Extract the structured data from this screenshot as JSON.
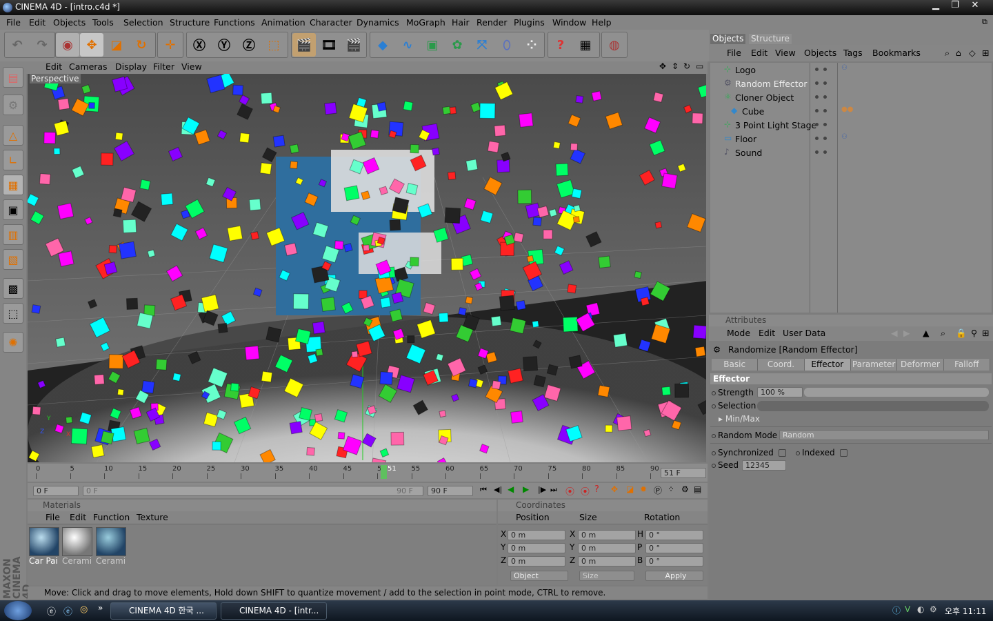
{
  "window": {
    "title": "CINEMA 4D - [intro.c4d *]"
  },
  "menubar": [
    "File",
    "Edit",
    "Objects",
    "Tools",
    "Selection",
    "Structure",
    "Functions",
    "Animation",
    "Character",
    "Dynamics",
    "MoGraph",
    "Hair",
    "Render",
    "Plugins",
    "Window",
    "Help"
  ],
  "viewport": {
    "menu": [
      "Edit",
      "Cameras",
      "Display",
      "Filter",
      "View"
    ],
    "label": "Perspective",
    "axis_y": "Y",
    "axis_x": "X",
    "axis_z": "Z"
  },
  "timeline": {
    "ticks": [
      "0",
      "5",
      "10",
      "15",
      "20",
      "25",
      "30",
      "35",
      "40",
      "45",
      "50",
      "55",
      "60",
      "65",
      "70",
      "75",
      "80",
      "85",
      "90"
    ],
    "marker": "51",
    "current_frame": "51 F"
  },
  "transport": {
    "start": "0 F",
    "range_start": "0 F",
    "range_end": "90 F",
    "end": "90 F"
  },
  "materials": {
    "title": "Materials",
    "menu": [
      "File",
      "Edit",
      "Function",
      "Texture"
    ],
    "items": [
      {
        "name": "Car Pai"
      },
      {
        "name": "Cerami"
      },
      {
        "name": "Cerami"
      }
    ]
  },
  "coordinates": {
    "title": "Coordinates",
    "headers": [
      "Position",
      "Size",
      "Rotation"
    ],
    "rows": [
      {
        "a": "X",
        "av": "0 m",
        "b": "X",
        "bv": "0 m",
        "c": "H",
        "cv": "0 °"
      },
      {
        "a": "Y",
        "av": "0 m",
        "b": "Y",
        "bv": "0 m",
        "c": "P",
        "cv": "0 °"
      },
      {
        "a": "Z",
        "av": "0 m",
        "b": "Z",
        "bv": "0 m",
        "c": "B",
        "cv": "0 °"
      }
    ],
    "mode": "Object",
    "size_mode": "Size",
    "apply": "Apply"
  },
  "status": "Move: Click and drag to move elements, Hold down SHIFT to quantize movement / add to the selection in point mode, CTRL to remove.",
  "branding": "MAXON CINEMA 4D",
  "objects_panel": {
    "tabs": [
      "Objects",
      "Structure"
    ],
    "menu": [
      "File",
      "Edit",
      "View",
      "Objects",
      "Tags",
      "Bookmarks"
    ],
    "items": [
      {
        "name": "Logo"
      },
      {
        "name": "Random Effector"
      },
      {
        "name": "Cloner Object"
      },
      {
        "name": "Cube"
      },
      {
        "name": "3 Point Light Stage"
      },
      {
        "name": "Floor"
      },
      {
        "name": "Sound"
      }
    ]
  },
  "attributes": {
    "title": "Attributes",
    "menu": [
      "Mode",
      "Edit",
      "User Data"
    ],
    "object": "Randomize [Random Effector]",
    "tabs": [
      "Basic",
      "Coord.",
      "Effector",
      "Parameter",
      "Deformer",
      "Falloff"
    ],
    "section": "Effector",
    "strength_label": "Strength",
    "strength_value": "100 %",
    "strength_percent": 100,
    "selection_label": "Selection",
    "minmax_label": "Min/Max",
    "random_mode_label": "Random Mode",
    "random_mode_value": "Random",
    "synchronized_label": "Synchronized",
    "indexed_label": "Indexed",
    "seed_label": "Seed",
    "seed_value": "12345"
  },
  "taskbar": {
    "tasks": [
      "CINEMA 4D 한국 ...",
      "CINEMA 4D - [intr..."
    ],
    "clock": "오후 11:11"
  }
}
